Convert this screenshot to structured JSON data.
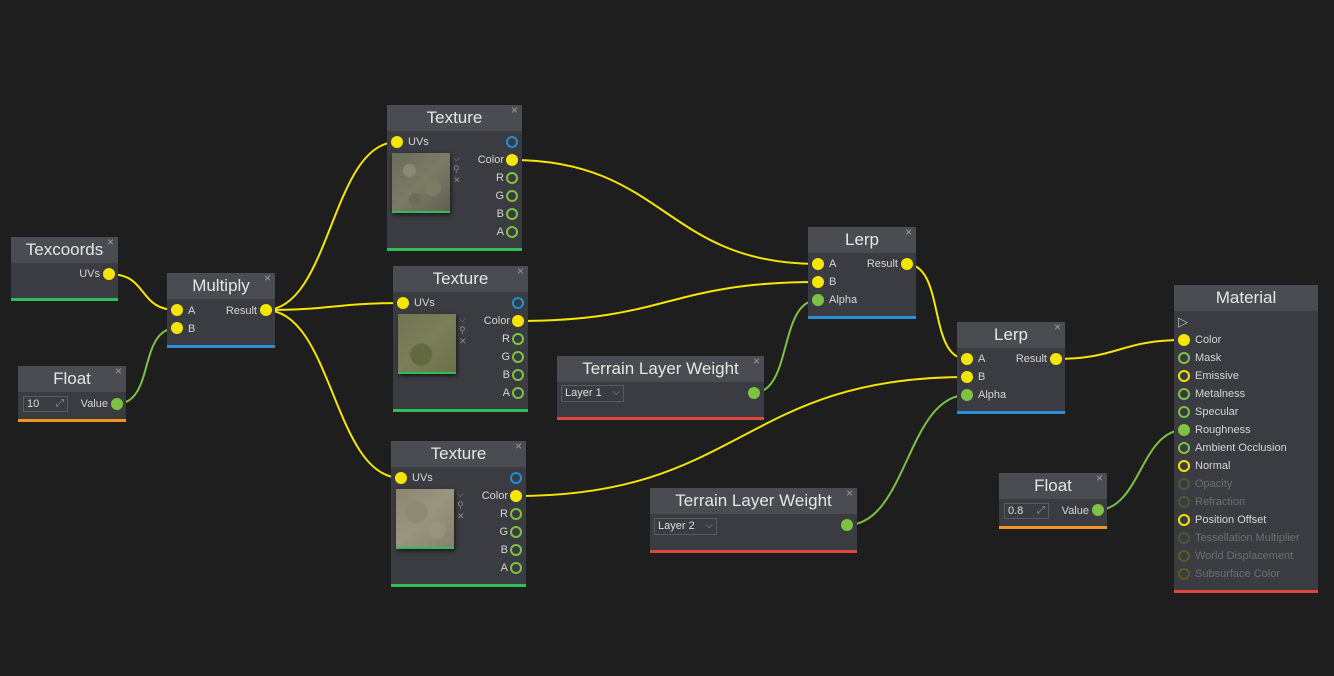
{
  "colors": {
    "background": "#1e1e1e",
    "node_body": "#3b3c41",
    "node_header": "#4b4c52",
    "pin_yellow": "#f5e600",
    "pin_green": "#7dc242",
    "pin_blue": "#1e90d6",
    "bar_green": "#2ebd59",
    "bar_blue": "#2d8fd6",
    "bar_orange": "#f0961e",
    "bar_red": "#e0463a"
  },
  "icons": {
    "close": "×",
    "expand": "⤢",
    "dropdown": "⌵",
    "search": "⚲",
    "remove": "✕",
    "output_arrow": "▷"
  },
  "nodes": {
    "texcoords": {
      "title": "Texcoords",
      "outputs": [
        "UVs"
      ]
    },
    "float1": {
      "title": "Float",
      "value": "10",
      "output": "Value"
    },
    "multiply": {
      "title": "Multiply",
      "inputs": [
        "A",
        "B"
      ],
      "output": "Result"
    },
    "texture1": {
      "title": "Texture",
      "input": "UVs",
      "outputs": [
        "Color",
        "R",
        "G",
        "B",
        "A"
      ]
    },
    "texture2": {
      "title": "Texture",
      "input": "UVs",
      "outputs": [
        "Color",
        "R",
        "G",
        "B",
        "A"
      ]
    },
    "texture3": {
      "title": "Texture",
      "input": "UVs",
      "outputs": [
        "Color",
        "R",
        "G",
        "B",
        "A"
      ]
    },
    "terrain1": {
      "title": "Terrain Layer Weight",
      "layer": "Layer 1"
    },
    "terrain2": {
      "title": "Terrain Layer Weight",
      "layer": "Layer 2"
    },
    "lerp1": {
      "title": "Lerp",
      "inputs": [
        "A",
        "B",
        "Alpha"
      ],
      "output": "Result"
    },
    "lerp2": {
      "title": "Lerp",
      "inputs": [
        "A",
        "B",
        "Alpha"
      ],
      "output": "Result"
    },
    "float2": {
      "title": "Float",
      "value": "0.8",
      "output": "Value"
    },
    "material": {
      "title": "Material",
      "inputs": [
        {
          "label": "Color",
          "state": "connected"
        },
        {
          "label": "Mask",
          "state": "available"
        },
        {
          "label": "Emissive",
          "state": "available"
        },
        {
          "label": "Metalness",
          "state": "available"
        },
        {
          "label": "Specular",
          "state": "available"
        },
        {
          "label": "Roughness",
          "state": "connected"
        },
        {
          "label": "Ambient Occlusion",
          "state": "available"
        },
        {
          "label": "Normal",
          "state": "available"
        },
        {
          "label": "Opacity",
          "state": "disabled"
        },
        {
          "label": "Refraction",
          "state": "disabled"
        },
        {
          "label": "Position Offset",
          "state": "available"
        },
        {
          "label": "Tessellation Multiplier",
          "state": "disabled"
        },
        {
          "label": "World Displacement",
          "state": "disabled"
        },
        {
          "label": "Subsurface Color",
          "state": "disabled"
        }
      ]
    }
  },
  "connections": [
    {
      "from": "texcoords.UVs",
      "to": "multiply.A"
    },
    {
      "from": "float1.Value",
      "to": "multiply.B"
    },
    {
      "from": "multiply.Result",
      "to": "texture1.UVs"
    },
    {
      "from": "multiply.Result",
      "to": "texture2.UVs"
    },
    {
      "from": "multiply.Result",
      "to": "texture3.UVs"
    },
    {
      "from": "texture1.Color",
      "to": "lerp1.A"
    },
    {
      "from": "texture2.Color",
      "to": "lerp1.B"
    },
    {
      "from": "terrain1.out",
      "to": "lerp1.Alpha"
    },
    {
      "from": "lerp1.Result",
      "to": "lerp2.A"
    },
    {
      "from": "texture3.Color",
      "to": "lerp2.B"
    },
    {
      "from": "terrain2.out",
      "to": "lerp2.Alpha"
    },
    {
      "from": "lerp2.Result",
      "to": "material.Color"
    },
    {
      "from": "float2.Value",
      "to": "material.Roughness"
    }
  ]
}
